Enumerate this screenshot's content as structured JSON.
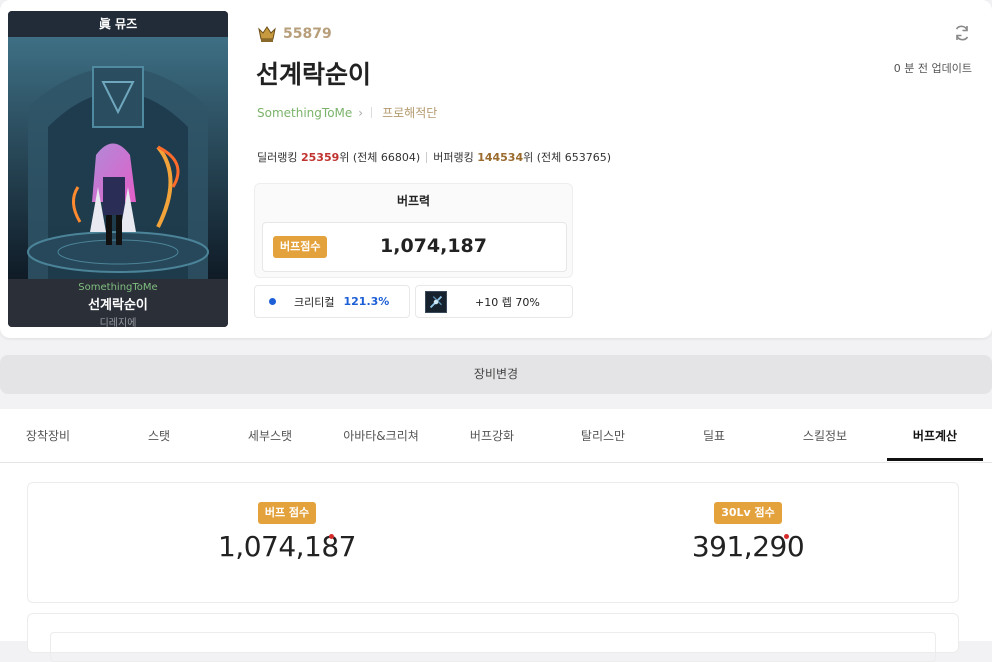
{
  "character": {
    "class_label": "眞 뮤즈",
    "guild": "SomethingToMe",
    "name": "선계락순이",
    "server": "디레지에"
  },
  "header": {
    "fame": "55879",
    "title": "선계락순이",
    "guild_link": "SomethingToMe",
    "adventure": "프로해적단",
    "update_text": "0 분 전 업데이트"
  },
  "ranking": {
    "dealer_label": "딜러랭킹",
    "dealer_rank": "25359",
    "dealer_suffix": "위 (전체 66804)",
    "buffer_label": "버퍼랭킹",
    "buffer_rank": "144534",
    "buffer_suffix": "위 (전체 653765)"
  },
  "buff_power": {
    "title": "버프력",
    "badge": "버프점수",
    "value": "1,074,187"
  },
  "stats": {
    "crit_label": "크리티컬",
    "crit_value": "121.3%",
    "weapon_label": "+10 렙 70%"
  },
  "equip_change_label": "장비변경",
  "tabs": [
    {
      "label": "장착장비"
    },
    {
      "label": "스탯"
    },
    {
      "label": "세부스탯"
    },
    {
      "label": "아바타&크리쳐"
    },
    {
      "label": "버프강화"
    },
    {
      "label": "탈리스만"
    },
    {
      "label": "딜표"
    },
    {
      "label": "스킬정보"
    },
    {
      "label": "버프계산"
    }
  ],
  "active_tab": "버프계산",
  "scores": {
    "buff_badge": "버프 점수",
    "buff_value": "1,074,187",
    "lv30_badge": "30Lv 점수",
    "lv30_value": "391,290"
  },
  "colors": {
    "accent_badge": "#e4a23c",
    "rank_red": "#c1332f",
    "crit_blue": "#1d5fd6",
    "guild_green": "#7bb36a"
  }
}
